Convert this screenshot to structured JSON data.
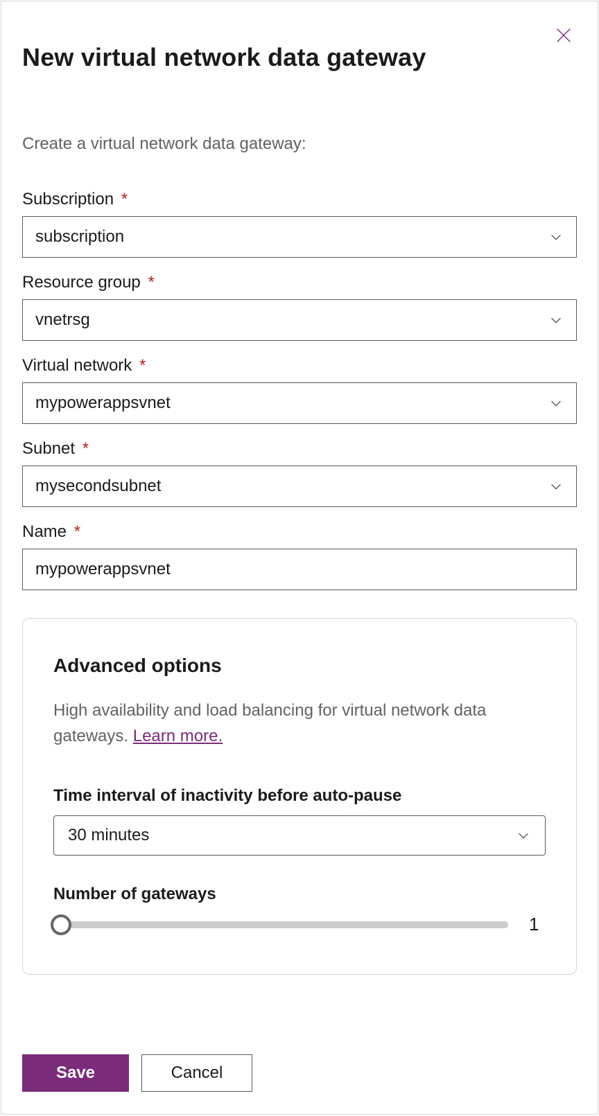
{
  "header": {
    "title": "New virtual network data gateway",
    "close_icon": "close-icon"
  },
  "form": {
    "subtitle": "Create a virtual network data gateway:",
    "fields": {
      "subscription": {
        "label": "Subscription",
        "required_mark": "*",
        "value": "subscription"
      },
      "resource_group": {
        "label": "Resource group",
        "required_mark": "*",
        "value": "vnetrsg"
      },
      "virtual_network": {
        "label": "Virtual network",
        "required_mark": "*",
        "value": "mypowerappsvnet"
      },
      "subnet": {
        "label": "Subnet",
        "required_mark": "*",
        "value": "mysecondsubnet"
      },
      "name": {
        "label": "Name",
        "required_mark": "*",
        "value": "mypowerappsvnet"
      }
    }
  },
  "advanced": {
    "title": "Advanced options",
    "description": "High availability and load balancing for virtual network data gateways. ",
    "learn_more": "Learn more.",
    "inactivity": {
      "label": "Time interval of inactivity before auto-pause",
      "value": "30 minutes"
    },
    "gateways": {
      "label": "Number of gateways",
      "value": "1"
    }
  },
  "footer": {
    "save": "Save",
    "cancel": "Cancel"
  }
}
